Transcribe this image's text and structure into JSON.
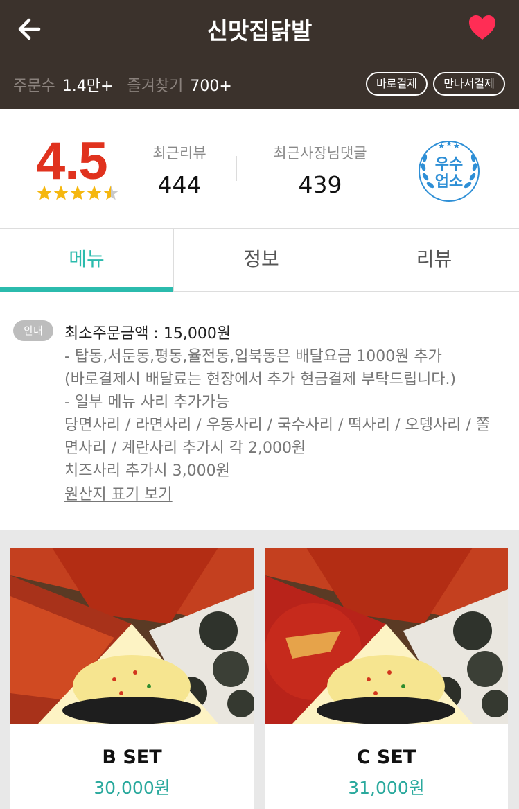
{
  "header": {
    "title": "신맛집닭발",
    "order_count_label": "주문수",
    "order_count_value": "1.4만+",
    "favorite_label": "즐겨찾기",
    "favorite_value": "700+",
    "pay_now_label": "바로결제",
    "pay_meet_label": "만나서결제",
    "heart_color": "#ff2d55"
  },
  "summary": {
    "rating": "4.5",
    "rating_value": 4.5,
    "rating_max": 5,
    "recent_reviews_label": "최근리뷰",
    "recent_reviews_value": "444",
    "owner_replies_label": "최근사장님댓글",
    "owner_replies_value": "439",
    "badge_line1": "우수",
    "badge_line2": "업소"
  },
  "tabs": [
    {
      "label": "메뉴",
      "active": true
    },
    {
      "label": "정보",
      "active": false
    },
    {
      "label": "리뷰",
      "active": false
    }
  ],
  "notice": {
    "tag": "안내",
    "title": "최소주문금액 : 15,000원",
    "lines": [
      "- 탑동,서둔동,평동,율전동,입북동은 배달요금 1000원 추가",
      " (바로결제시 배달료는 현장에서 추가 현금결제 부탁드립니다.)",
      "- 일부 메뉴 사리 추가가능",
      "당면사리 / 라면사리 / 우동사리 / 국수사리 / 떡사리 / 오뎅사리 / 쫄",
      "면사리 / 계란사리 추가시 각 2,000원",
      "치즈사리 추가시 3,000원"
    ],
    "origin_link": "원산지 표기 보기"
  },
  "menu": [
    {
      "name": "B SET",
      "price": "30,000원"
    },
    {
      "name": "C SET",
      "price": "31,000원"
    }
  ],
  "colors": {
    "header_bg": "#3b322c",
    "rating_red": "#e0321e",
    "accent_teal": "#2bbbad",
    "price_teal": "#2aa99d",
    "star_yellow": "#f5b70f",
    "badge_blue": "#2e8fd6"
  }
}
